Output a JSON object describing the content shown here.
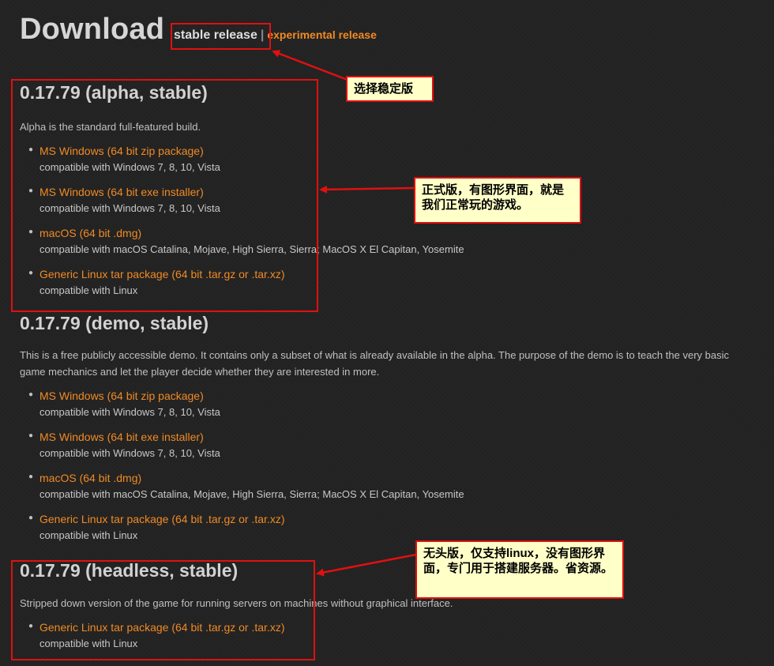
{
  "header": {
    "title": "Download",
    "tab_stable": "stable release",
    "separator": "|",
    "tab_experimental": "experimental release"
  },
  "sections": [
    {
      "heading": "0.17.79 (alpha, stable)",
      "description": "Alpha is the standard full-featured build.",
      "items": [
        {
          "link": "MS Windows (64 bit zip package)",
          "compat": "compatible with Windows 7, 8, 10, Vista"
        },
        {
          "link": "MS Windows (64 bit exe installer)",
          "compat": "compatible with Windows 7, 8, 10, Vista"
        },
        {
          "link": "macOS (64 bit .dmg)",
          "compat": "compatible with macOS Catalina, Mojave, High Sierra, Sierra; MacOS X El Capitan, Yosemite"
        },
        {
          "link": "Generic Linux tar package (64 bit .tar.gz or .tar.xz)",
          "compat": "compatible with Linux"
        }
      ]
    },
    {
      "heading": "0.17.79 (demo, stable)",
      "description": "This is a free publicly accessible demo. It contains only a subset of what is already available in the alpha. The purpose of the demo is to teach the very basic game mechanics and let the player decide whether they are interested in more.",
      "items": [
        {
          "link": "MS Windows (64 bit zip package)",
          "compat": "compatible with Windows 7, 8, 10, Vista"
        },
        {
          "link": "MS Windows (64 bit exe installer)",
          "compat": "compatible with Windows 7, 8, 10, Vista"
        },
        {
          "link": "macOS (64 bit .dmg)",
          "compat": "compatible with macOS Catalina, Mojave, High Sierra, Sierra; MacOS X El Capitan, Yosemite"
        },
        {
          "link": "Generic Linux tar package (64 bit .tar.gz or .tar.xz)",
          "compat": "compatible with Linux"
        }
      ]
    },
    {
      "heading": "0.17.79 (headless, stable)",
      "description": "Stripped down version of the game for running servers on machines without graphical interface.",
      "items": [
        {
          "link": "Generic Linux tar package (64 bit .tar.gz or .tar.xz)",
          "compat": "compatible with Linux"
        }
      ]
    }
  ],
  "annotations": {
    "note1": "选择稳定版",
    "note2": "正式版，有图形界面，就是我们正常玩的游戏。",
    "note3": "无头版，仅支持linux，没有图形界面，专门用于搭建服务器。省资源。"
  },
  "colors": {
    "background": "#222222",
    "link": "#f08a24",
    "annotation_border": "#e01010",
    "annotation_fill": "#ffffc8"
  }
}
